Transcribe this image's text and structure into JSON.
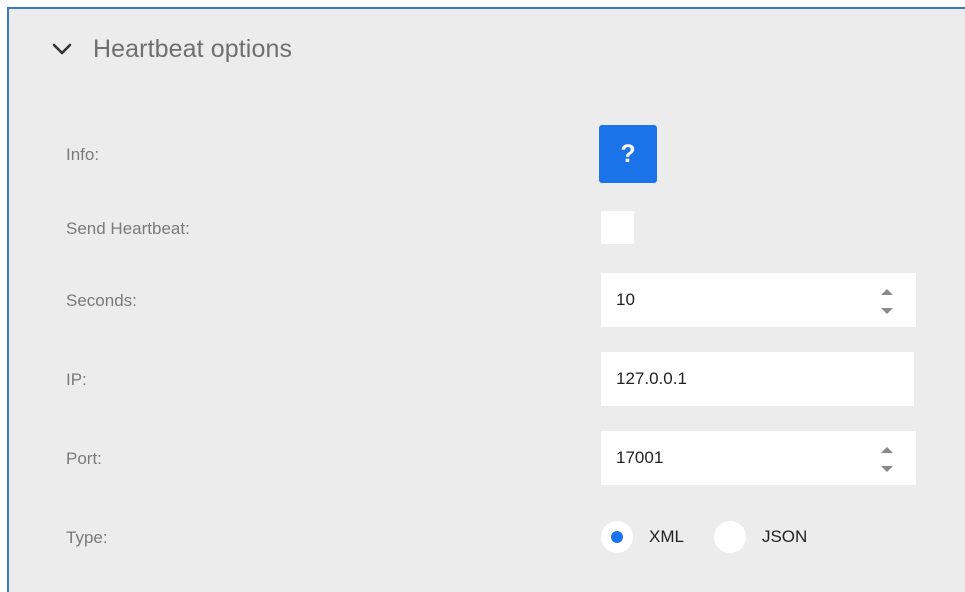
{
  "section": {
    "title": "Heartbeat options",
    "expanded": true,
    "chevron_icon": "chevron-down-icon"
  },
  "info": {
    "label": "Info:",
    "button_glyph": "?",
    "button_icon": "help-icon",
    "button_color": "#1a73e8"
  },
  "send_heartbeat": {
    "label": "Send Heartbeat:",
    "checked": false
  },
  "seconds": {
    "label": "Seconds:",
    "value": "10"
  },
  "ip": {
    "label": "IP:",
    "value": "127.0.0.1"
  },
  "port": {
    "label": "Port:",
    "value": "17001"
  },
  "type": {
    "label": "Type:",
    "options": [
      "XML",
      "JSON"
    ],
    "selected": "XML"
  },
  "colors": {
    "panel_background": "#ececec",
    "panel_border": "#3a7bbf",
    "accent": "#1a73e8"
  }
}
